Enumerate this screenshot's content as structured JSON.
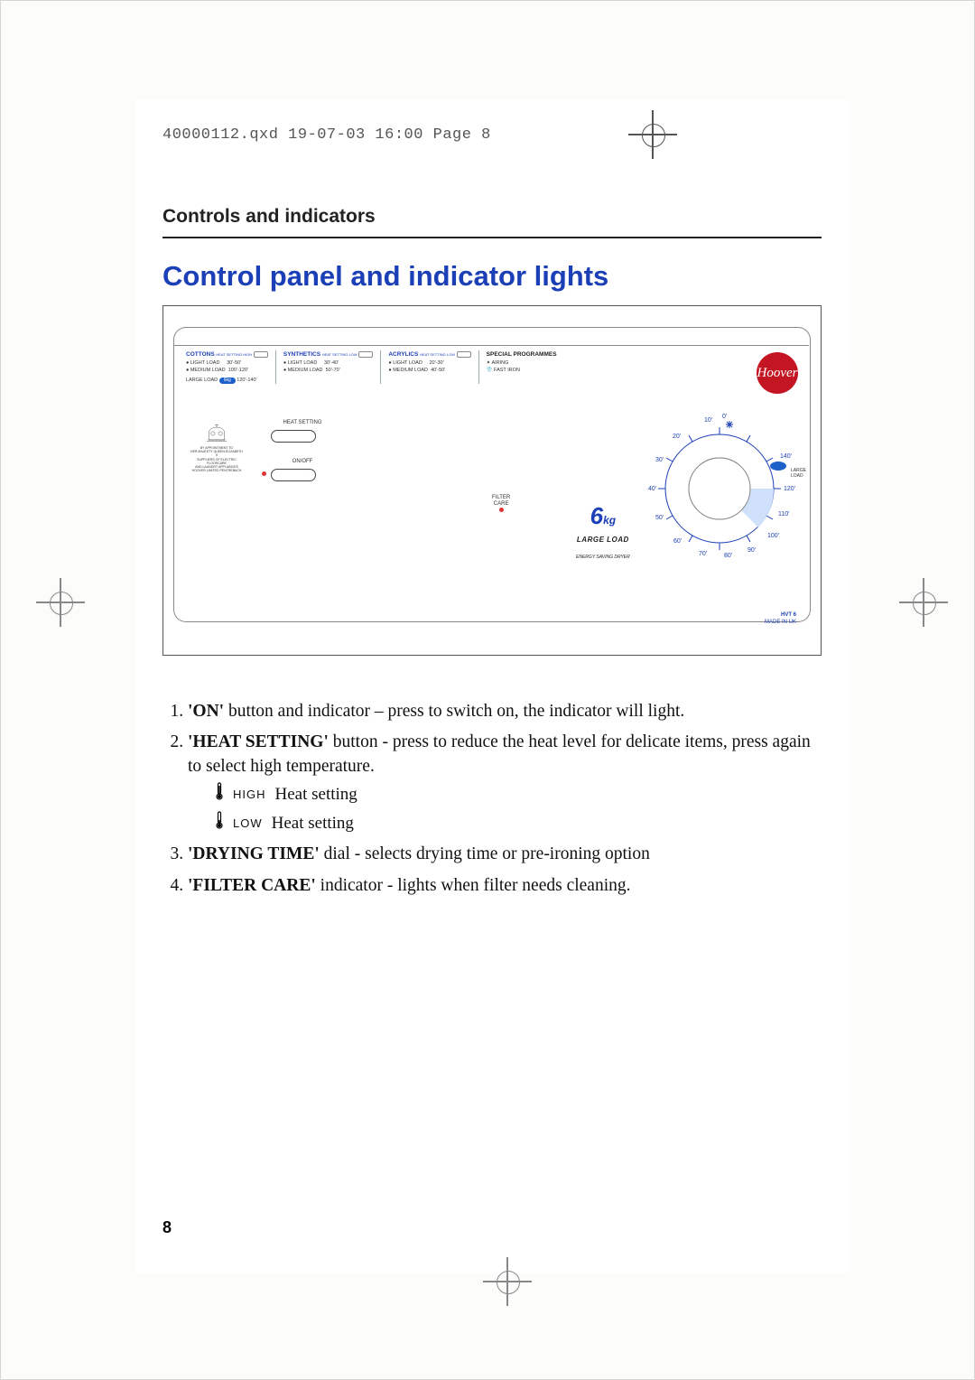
{
  "header_line": "40000112.qxd  19-07-03  16:00  Page 8",
  "section_title": "Controls and indicators",
  "page_heading": "Control panel and indicator lights",
  "page_number": "8",
  "panel": {
    "programmes": {
      "cottons": {
        "label": "COTTONS",
        "note": "HEAT SETTING HIGH",
        "rows": [
          {
            "a": "● LIGHT LOAD",
            "b": "30'-50'"
          },
          {
            "a": "● MEDIUM LOAD",
            "b": "100'-120'"
          }
        ],
        "large": {
          "label": "LARGE LOAD",
          "pill": "6kg",
          "time": "120'-140'"
        }
      },
      "synthetics": {
        "label": "SYNTHETICS",
        "note": "HEAT SETTING LOW",
        "rows": [
          {
            "a": "● LIGHT LOAD",
            "b": "30'-40'"
          },
          {
            "a": "● MEDIUM LOAD",
            "b": "50'-70'"
          }
        ]
      },
      "acrylics": {
        "label": "ACRYLICS",
        "note": "HEAT SETTING LOW",
        "rows": [
          {
            "a": "● LIGHT LOAD",
            "b": "20'-30'"
          },
          {
            "a": "● MEDIUM LOAD",
            "b": "40'-50'"
          }
        ]
      },
      "special": {
        "label": "SPECIAL PROGRAMMES",
        "rows": [
          {
            "a": "✦  AIRING",
            "b": ""
          },
          {
            "a": "👕  FAST IRON",
            "b": ""
          }
        ]
      }
    },
    "heat_setting_label": "HEAT SETTING",
    "onoff_label": "ON/OFF",
    "filter_care_label": "FILTER\nCARE",
    "capacity": {
      "num": "6",
      "unit": "kg",
      "large": "LARGE LOAD",
      "sub": "ENERGY SAVING DRYER"
    },
    "logo": "Hoover",
    "dial_ticks": [
      "0'",
      "10'",
      "20'",
      "30'",
      "40'",
      "50'",
      "60'",
      "70'",
      "80'",
      "90'",
      "100'",
      "110'",
      "120'",
      "140'"
    ],
    "dial_right_label": "LARGE LOAD",
    "made": {
      "a": "HVT 6",
      "b": "MADE IN UK"
    }
  },
  "list": {
    "item1_bold": "'ON'",
    "item1_rest": " button and indicator – press to switch on, the indicator will light.",
    "item2_bold": "'HEAT SETTING'",
    "item2_rest": " button - press to reduce the heat level for delicate items, press again to select high temperature.",
    "high_small": "HIGH",
    "high_rest": " Heat setting",
    "low_small": "LOW",
    "low_rest": " Heat setting",
    "item3_bold": "'DRYING TIME'",
    "item3_rest": " dial - selects drying time or pre-ironing option",
    "item4_bold": "'FILTER CARE'",
    "item4_rest": " indicator - lights when filter needs cleaning."
  }
}
